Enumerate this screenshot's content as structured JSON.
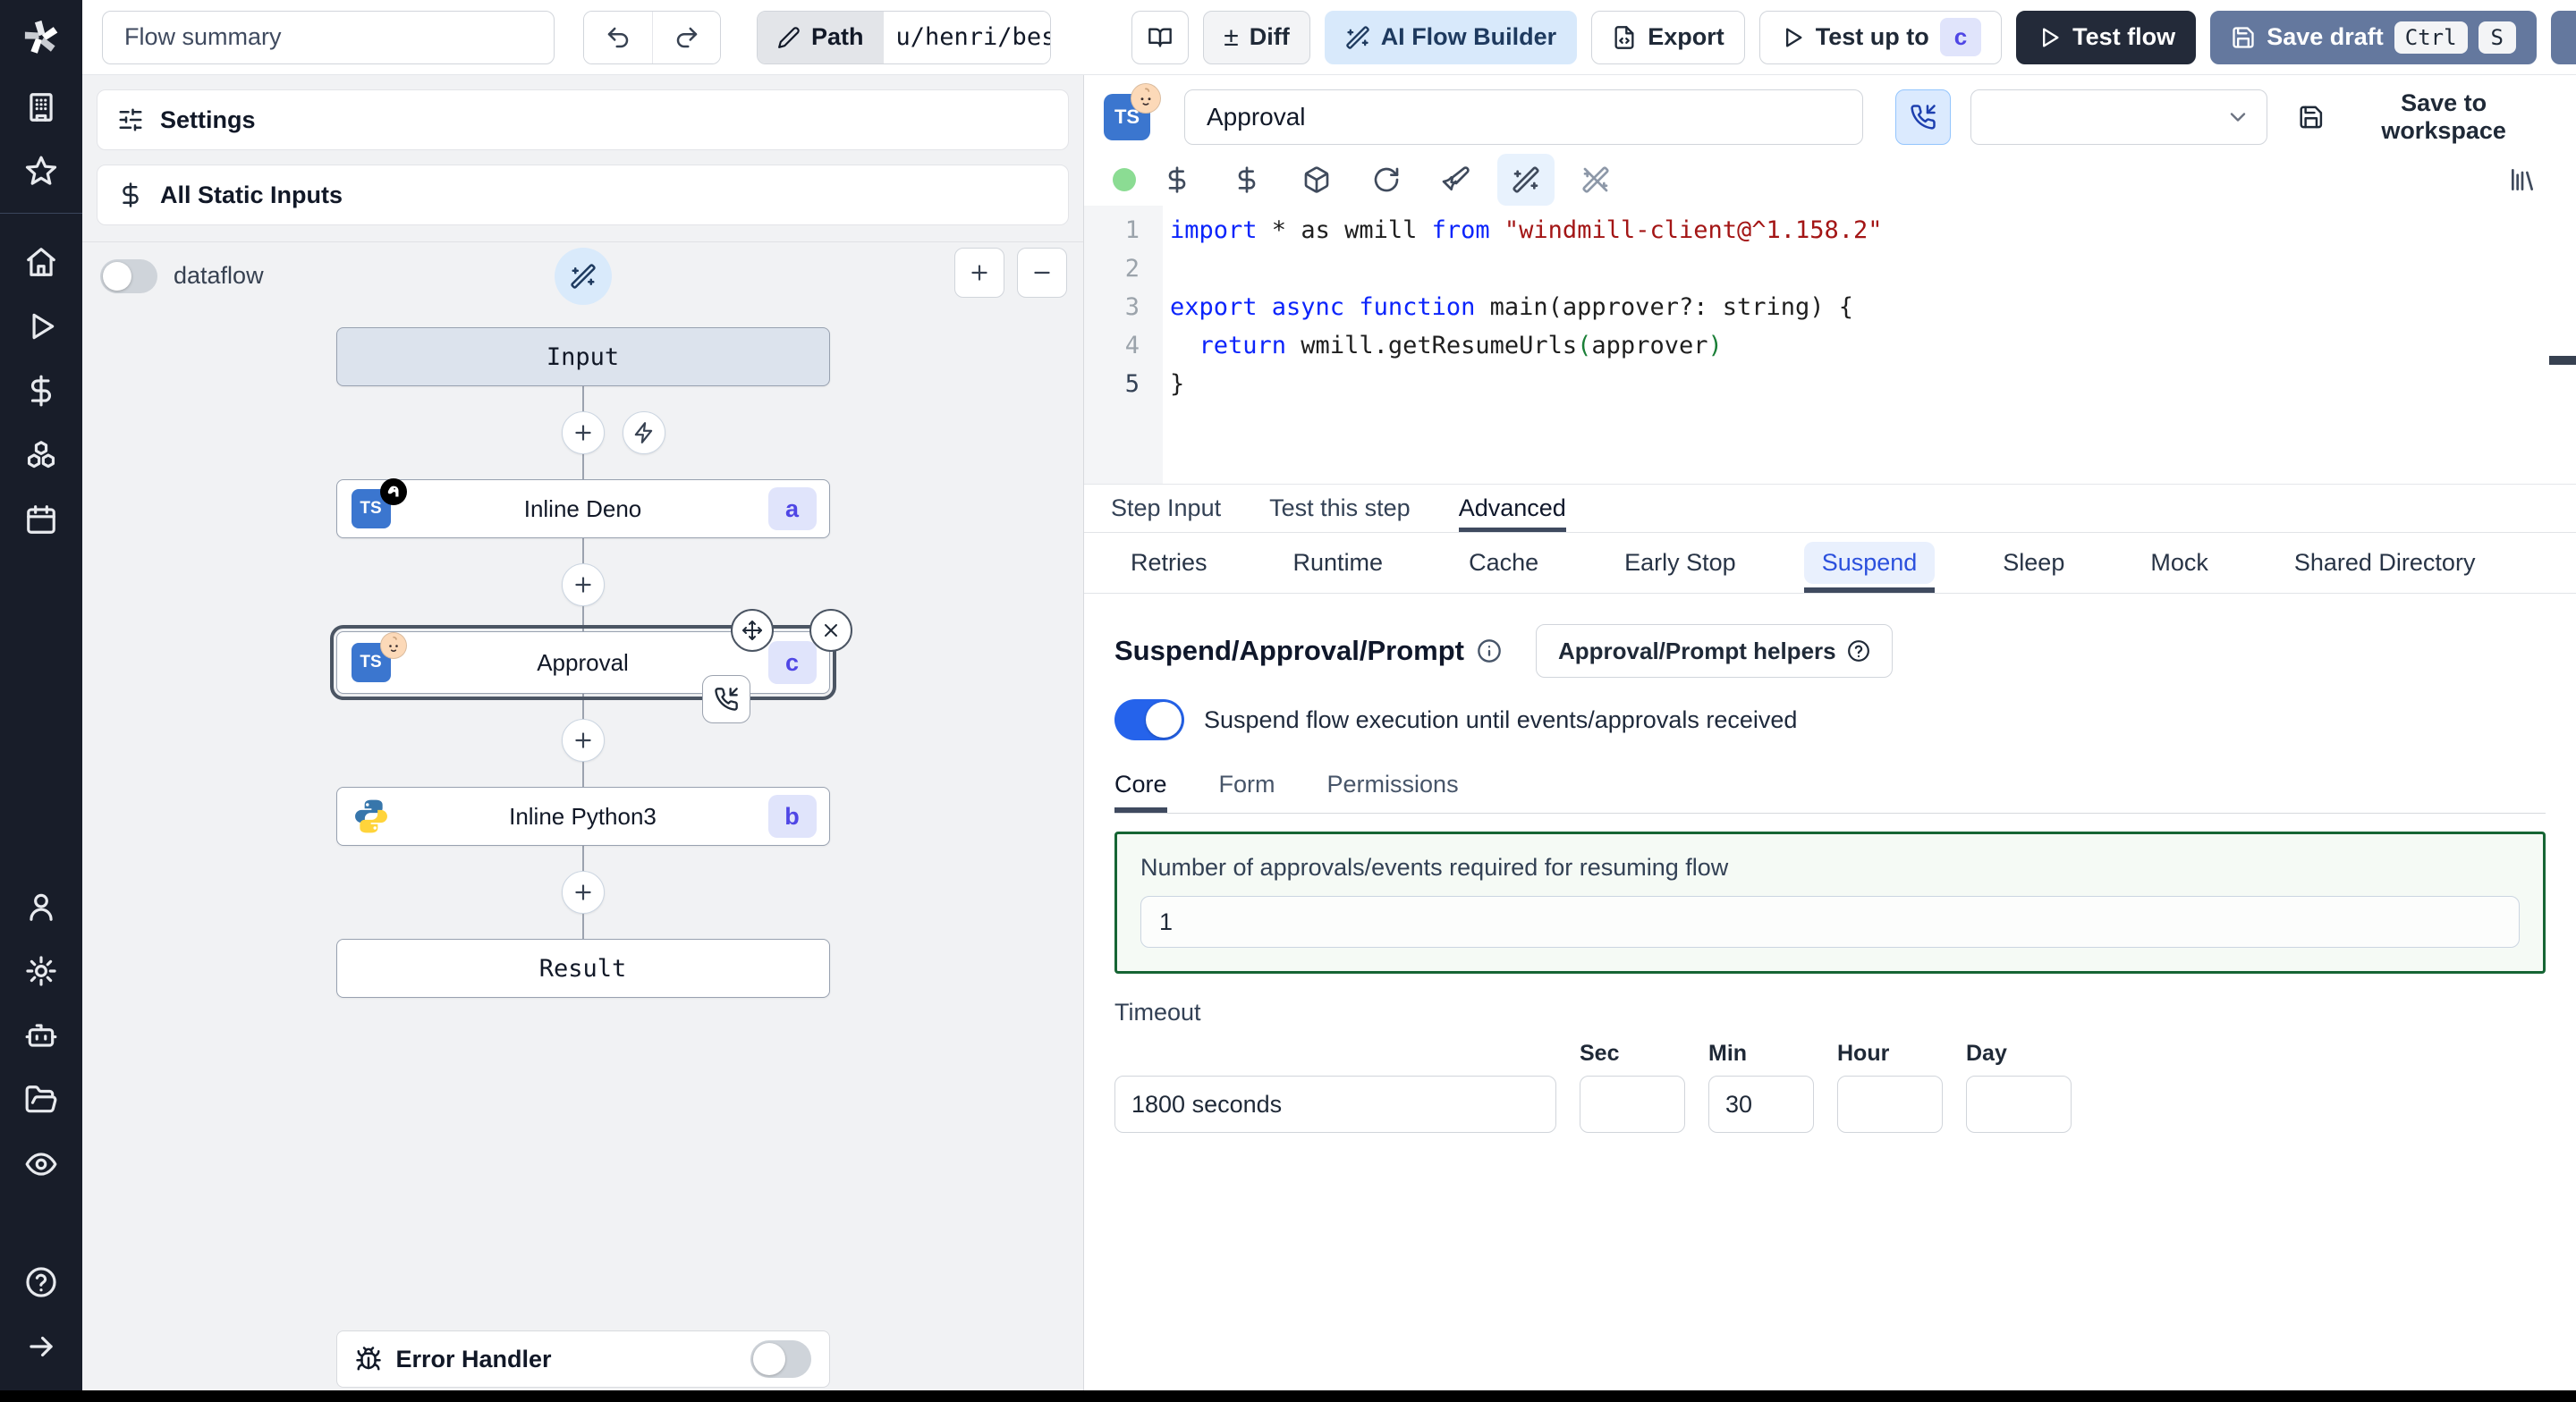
{
  "colors": {
    "accent": "#2563eb",
    "badge_bg": "#e0e4fb",
    "badge_text": "#4f46e5",
    "save_draft_bg": "#64789e",
    "test_flow_bg": "#232a39",
    "ai_builder_bg": "#d8e9fb",
    "suspend_box_border": "#166534",
    "status_dot": "#8bdc93"
  },
  "topbar": {
    "flow_summary": "Flow summary",
    "path_label": "Path",
    "path_value": "u/henri/bes",
    "diff": "Diff",
    "diff_glyph": "±",
    "ai_flow_builder": "AI Flow Builder",
    "export": "Export",
    "test_up_to": "Test up to",
    "test_up_to_badge": "c",
    "test_flow": "Test flow",
    "save_draft": "Save draft",
    "kbd": [
      "Ctrl",
      "S"
    ]
  },
  "sidebar_icons": [
    "windmill-logo",
    "workspace",
    "favorites",
    "home",
    "runs",
    "variables",
    "resources",
    "schedules",
    "users",
    "settings",
    "workers",
    "folders",
    "audit-logs",
    "help",
    "collapse"
  ],
  "flow_panel": {
    "settings": "Settings",
    "all_static_inputs": "All Static Inputs",
    "dataflow": "dataflow",
    "input_node": "Input",
    "result_node": "Result",
    "ts_label": "TS",
    "steps": [
      {
        "label": "Inline Deno",
        "badge": "a",
        "lang": "deno"
      },
      {
        "label": "Approval",
        "badge": "c",
        "lang": "approval-typescript"
      },
      {
        "label": "Inline Python3",
        "badge": "b",
        "lang": "python3"
      }
    ],
    "error_handler": "Error Handler"
  },
  "step_panel": {
    "title": "Approval",
    "save_to_workspace": "Save to workspace",
    "tabs": [
      "Step Input",
      "Test this step",
      "Advanced"
    ],
    "active_tab": "Advanced",
    "subtabs": [
      "Retries",
      "Runtime",
      "Cache",
      "Early Stop",
      "Suspend",
      "Sleep",
      "Mock",
      "Shared Directory"
    ],
    "active_subtab": "Suspend",
    "editor": {
      "numbers": [
        "1",
        "2",
        "3",
        "4",
        "5"
      ],
      "l1": {
        "kw1": "import",
        "plain1": " * as wmill ",
        "kw2": "from",
        "str": " \"windmill-client@^1.158.2\""
      },
      "l3": {
        "kw1": "export async function",
        "plain1": " main(approver?: string) {"
      },
      "l4": {
        "kw1": "  return",
        "plain1": " wmill.getResumeUrls",
        "p1": "(",
        "plain2": "approver",
        "p2": ")"
      },
      "l5": {
        "plain1": "}"
      }
    },
    "suspend": {
      "heading": "Suspend/Approval/Prompt",
      "helpers": "Approval/Prompt helpers",
      "toggle_label": "Suspend flow execution until events/approvals received",
      "tabs": [
        "Core",
        "Form",
        "Permissions"
      ],
      "active_tab": "Core",
      "approvals_label": "Number of approvals/events required for resuming flow",
      "approvals_value": "1",
      "timeout_label": "Timeout",
      "timeout_value": "1800 seconds",
      "units": [
        {
          "label": "Sec",
          "value": ""
        },
        {
          "label": "Min",
          "value": "30"
        },
        {
          "label": "Hour",
          "value": ""
        },
        {
          "label": "Day",
          "value": ""
        }
      ]
    }
  }
}
